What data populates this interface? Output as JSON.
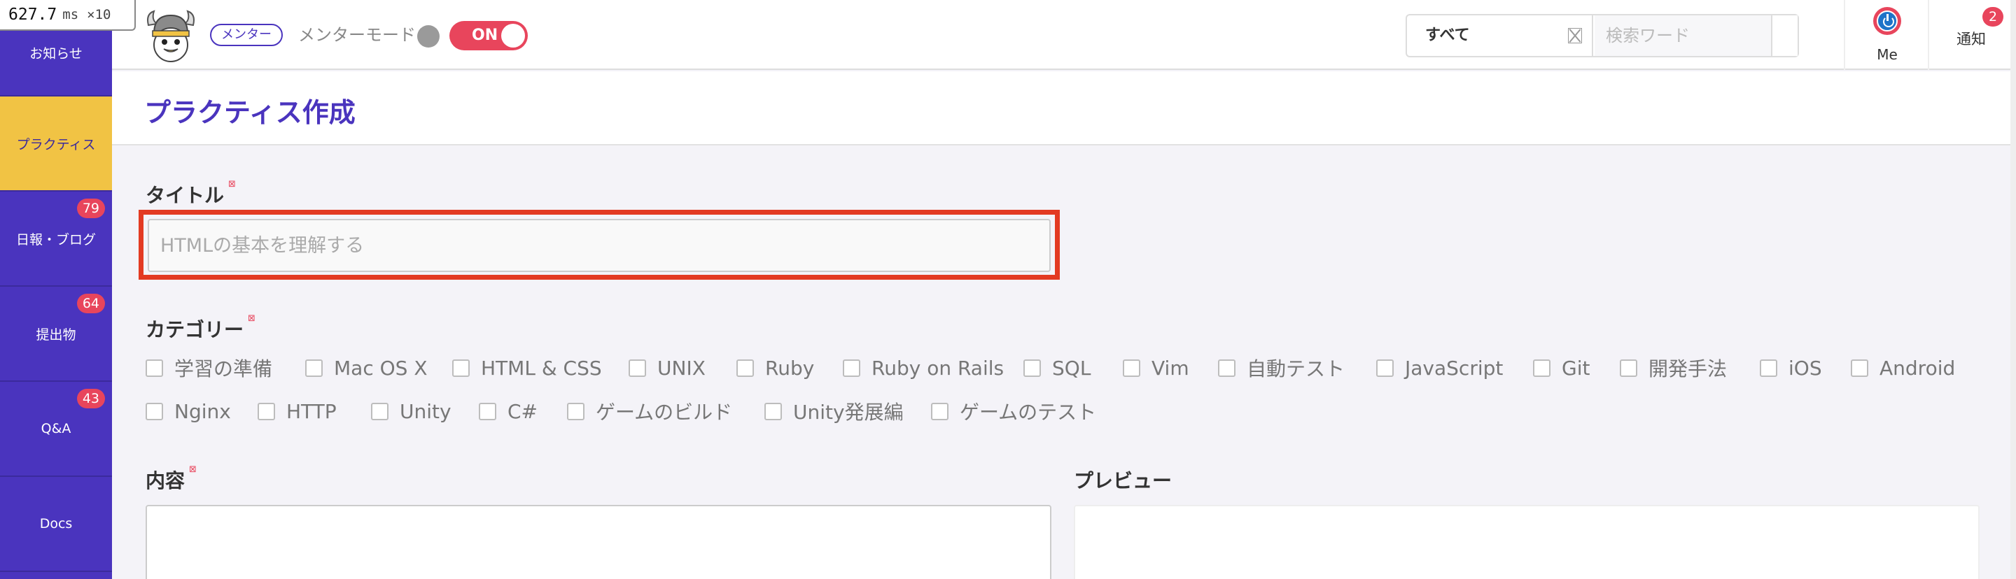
{
  "timer": {
    "value": "627.7",
    "unit": "ms",
    "multiplier": "×10"
  },
  "sidebar": {
    "items": [
      {
        "label": "お知らせ",
        "badge": ""
      },
      {
        "label": "プラクティス",
        "badge": "",
        "active": true
      },
      {
        "label": "日報・ブログ",
        "badge": "79"
      },
      {
        "label": "提出物",
        "badge": "64"
      },
      {
        "label": "Q&A",
        "badge": "43"
      },
      {
        "label": "Docs",
        "badge": ""
      }
    ]
  },
  "header": {
    "mentor_badge": "メンター",
    "mentor_mode": "メンターモード",
    "switch_label": "ON",
    "search": {
      "select_value": "すべて",
      "placeholder": "検索ワード"
    },
    "me_label": "Me",
    "notice_label": "通知",
    "notice_count": "2"
  },
  "page": {
    "title": "プラクティス作成"
  },
  "form": {
    "title_label": "タイトル",
    "title_placeholder": "HTMLの基本を理解する",
    "category_label": "カテゴリー",
    "categories": [
      "学習の準備",
      "Mac OS X",
      "HTML & CSS",
      "UNIX",
      "Ruby",
      "Ruby on Rails",
      "SQL",
      "Vim",
      "自動テスト",
      "JavaScript",
      "Git",
      "開発手法",
      "iOS",
      "Android",
      "Nginx",
      "HTTP",
      "Unity",
      "C#",
      "ゲームのビルド",
      "Unity発展編",
      "ゲームのテスト"
    ],
    "content_label": "内容",
    "preview_label": "プレビュー"
  },
  "colors": {
    "brand": "#4a34be",
    "accent": "#e8455c",
    "active": "#f1c344",
    "highlight": "#e33a22"
  }
}
